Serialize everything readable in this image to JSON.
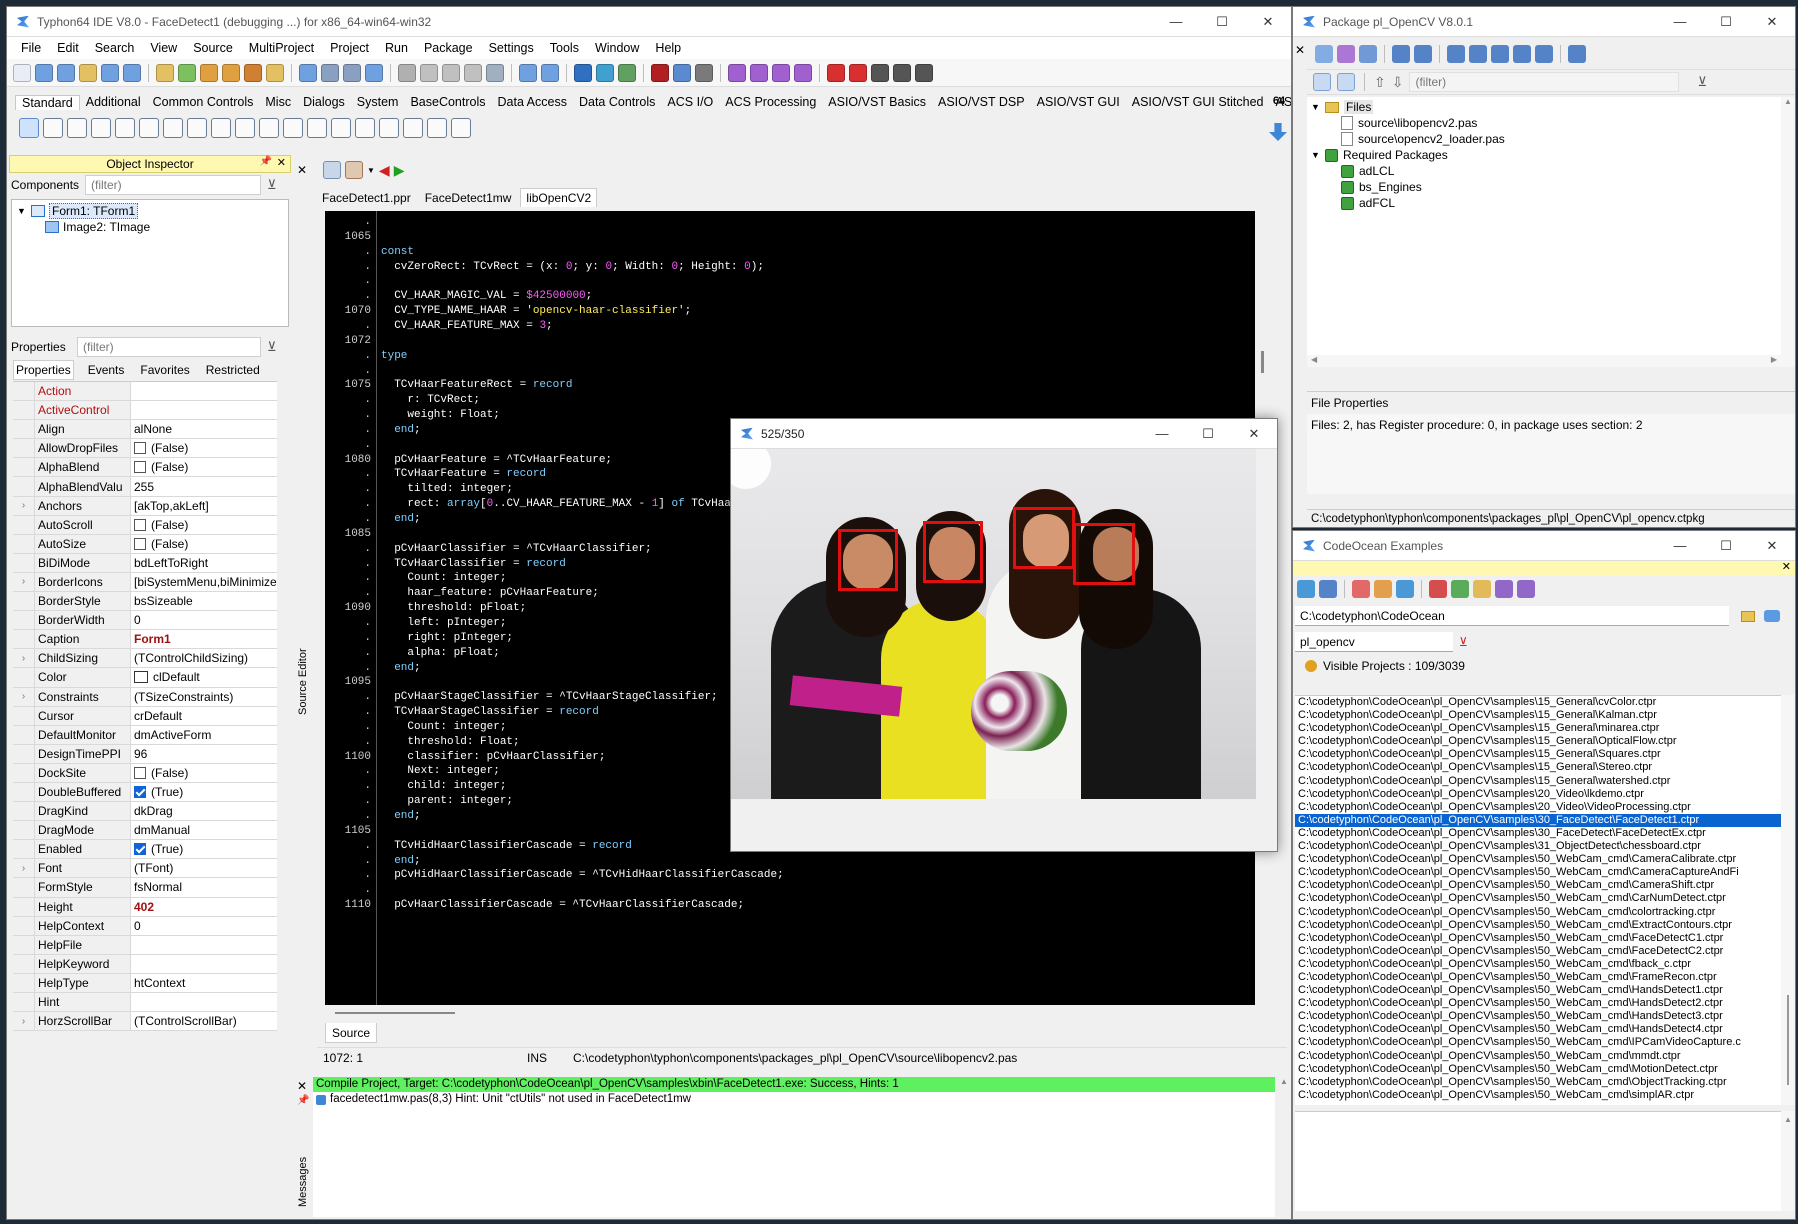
{
  "ide": {
    "title": "Typhon64 IDE V8.0 - FaceDetect1 (debugging ...) for x86_64-win64-win32",
    "menu": [
      "File",
      "Edit",
      "Search",
      "View",
      "Source",
      "MultiProject",
      "Project",
      "Run",
      "Package",
      "Settings",
      "Tools",
      "Window",
      "Help"
    ],
    "palette_tabs": [
      "Standard",
      "Additional",
      "Common Controls",
      "Misc",
      "Dialogs",
      "System",
      "BaseControls",
      "Data Access",
      "Data Controls",
      "ACS I/O",
      "ACS Processing",
      "ASIO/VST Basics",
      "ASIO/VST DSP",
      "ASIO/VST GUI",
      "ASIO/VST GUI Stitched",
      "ASIO/"
    ],
    "arch_label": "64"
  },
  "object_inspector": {
    "title": "Object Inspector",
    "components_label": "Components",
    "filter_placeholder": "(filter)",
    "tree": [
      "Form1: TForm1",
      "Image2: TImage"
    ],
    "properties_label": "Properties",
    "tabs": [
      "Properties",
      "Events",
      "Favorites",
      "Restricted"
    ],
    "rows": [
      {
        "exp": "",
        "name": "Action",
        "value": "",
        "kind": "red"
      },
      {
        "exp": "",
        "name": "ActiveControl",
        "value": "",
        "kind": "red"
      },
      {
        "exp": "",
        "name": "Align",
        "value": "alNone",
        "kind": ""
      },
      {
        "exp": "",
        "name": "AllowDropFiles",
        "value": "(False)",
        "kind": "chk"
      },
      {
        "exp": "",
        "name": "AlphaBlend",
        "value": "(False)",
        "kind": "chk"
      },
      {
        "exp": "",
        "name": "AlphaBlendValu",
        "value": "255",
        "kind": ""
      },
      {
        "exp": "›",
        "name": "Anchors",
        "value": "[akTop,akLeft]",
        "kind": ""
      },
      {
        "exp": "",
        "name": "AutoScroll",
        "value": "(False)",
        "kind": "chk"
      },
      {
        "exp": "",
        "name": "AutoSize",
        "value": "(False)",
        "kind": "chk"
      },
      {
        "exp": "",
        "name": "BiDiMode",
        "value": "bdLeftToRight",
        "kind": ""
      },
      {
        "exp": "›",
        "name": "BorderIcons",
        "value": "[biSystemMenu,biMinimize",
        "kind": ""
      },
      {
        "exp": "",
        "name": "BorderStyle",
        "value": "bsSizeable",
        "kind": ""
      },
      {
        "exp": "",
        "name": "BorderWidth",
        "value": "0",
        "kind": ""
      },
      {
        "exp": "",
        "name": "Caption",
        "value": "Form1",
        "kind": "bold"
      },
      {
        "exp": "›",
        "name": "ChildSizing",
        "value": "(TControlChildSizing)",
        "kind": ""
      },
      {
        "exp": "",
        "name": "Color",
        "value": "clDefault",
        "kind": "color"
      },
      {
        "exp": "›",
        "name": "Constraints",
        "value": "(TSizeConstraints)",
        "kind": ""
      },
      {
        "exp": "",
        "name": "Cursor",
        "value": "crDefault",
        "kind": ""
      },
      {
        "exp": "",
        "name": "DefaultMonitor",
        "value": "dmActiveForm",
        "kind": ""
      },
      {
        "exp": "",
        "name": "DesignTimePPI",
        "value": "96",
        "kind": ""
      },
      {
        "exp": "",
        "name": "DockSite",
        "value": "(False)",
        "kind": "chk"
      },
      {
        "exp": "",
        "name": "DoubleBuffered",
        "value": "(True)",
        "kind": "chkon"
      },
      {
        "exp": "",
        "name": "DragKind",
        "value": "dkDrag",
        "kind": ""
      },
      {
        "exp": "",
        "name": "DragMode",
        "value": "dmManual",
        "kind": ""
      },
      {
        "exp": "",
        "name": "Enabled",
        "value": "(True)",
        "kind": "chkon"
      },
      {
        "exp": "›",
        "name": "Font",
        "value": "(TFont)",
        "kind": ""
      },
      {
        "exp": "",
        "name": "FormStyle",
        "value": "fsNormal",
        "kind": ""
      },
      {
        "exp": "",
        "name": "Height",
        "value": "402",
        "kind": "bold"
      },
      {
        "exp": "",
        "name": "HelpContext",
        "value": "0",
        "kind": ""
      },
      {
        "exp": "",
        "name": "HelpFile",
        "value": "",
        "kind": ""
      },
      {
        "exp": "",
        "name": "HelpKeyword",
        "value": "",
        "kind": ""
      },
      {
        "exp": "",
        "name": "HelpType",
        "value": "htContext",
        "kind": ""
      },
      {
        "exp": "",
        "name": "Hint",
        "value": "",
        "kind": ""
      },
      {
        "exp": "›",
        "name": "HorzScrollBar",
        "value": "(TControlScrollBar)",
        "kind": ""
      }
    ]
  },
  "editor": {
    "tabs": [
      "FaceDetect1.ppr",
      "FaceDetect1mw",
      "libOpenCV2"
    ],
    "side_label": "Source Editor",
    "bottom_tab": "Source",
    "status_pos": "1072: 1",
    "status_mode": "INS",
    "status_path": "C:\\codetyphon\\typhon\\components\\packages_pl\\pl_OpenCV\\source\\libopencv2.pas",
    "lines": [
      {
        "n": ".",
        "t": ""
      },
      {
        "n": "1065",
        "t": ""
      },
      {
        "n": ".",
        "t": "<span class='kw'>const</span>"
      },
      {
        "n": ".",
        "t": "  cvZeroRect: TCvRect = (x: <span class='num'>0</span>; y: <span class='num'>0</span>; Width: <span class='num'>0</span>; Height: <span class='num'>0</span>);"
      },
      {
        "n": ".",
        "t": ""
      },
      {
        "n": ".",
        "t": "  CV_HAAR_MAGIC_VAL = <span class='num'>$42500000</span>;"
      },
      {
        "n": "1070",
        "t": "  CV_TYPE_NAME_HAAR = <span class='str'>'opencv-haar-classifier'</span>;"
      },
      {
        "n": ".",
        "t": "  CV_HAAR_FEATURE_MAX = <span class='num'>3</span>;"
      },
      {
        "n": "1072",
        "t": ""
      },
      {
        "n": ".",
        "t": "<span class='kw'>type</span>"
      },
      {
        "n": ".",
        "t": ""
      },
      {
        "n": "1075",
        "t": "  TCvHaarFeatureRect = <span class='kw'>record</span>"
      },
      {
        "n": ".",
        "t": "    r: TCvRect;"
      },
      {
        "n": ".",
        "t": "    weight: Float;"
      },
      {
        "n": ".",
        "t": "  <span class='kw'>end</span>;"
      },
      {
        "n": ".",
        "t": ""
      },
      {
        "n": "1080",
        "t": "  pCvHaarFeature = ^TCvHaarFeature;"
      },
      {
        "n": ".",
        "t": "  TCvHaarFeature = <span class='kw'>record</span>"
      },
      {
        "n": ".",
        "t": "    tilted: integer;"
      },
      {
        "n": ".",
        "t": "    rect: <span class='kw'>array</span>[<span class='num'>0</span>..CV_HAAR_FEATURE_MAX - <span class='num'>1</span>] <span class='kw'>of</span> TCvHaarFeatureRect;"
      },
      {
        "n": ".",
        "t": "  <span class='kw'>end</span>;"
      },
      {
        "n": "1085",
        "t": ""
      },
      {
        "n": ".",
        "t": "  pCvHaarClassifier = ^TCvHaarClassifier;"
      },
      {
        "n": ".",
        "t": "  TCvHaarClassifier = <span class='kw'>record</span>"
      },
      {
        "n": ".",
        "t": "    Count: integer;"
      },
      {
        "n": ".",
        "t": "    haar_feature: pCvHaarFeature;"
      },
      {
        "n": "1090",
        "t": "    threshold: pFloat;"
      },
      {
        "n": ".",
        "t": "    left: pInteger;"
      },
      {
        "n": ".",
        "t": "    right: pInteger;"
      },
      {
        "n": ".",
        "t": "    alpha: pFloat;"
      },
      {
        "n": ".",
        "t": "  <span class='kw'>end</span>;"
      },
      {
        "n": "1095",
        "t": ""
      },
      {
        "n": ".",
        "t": "  pCvHaarStageClassifier = ^TCvHaarStageClassifier;"
      },
      {
        "n": ".",
        "t": "  TCvHaarStageClassifier = <span class='kw'>record</span>"
      },
      {
        "n": ".",
        "t": "    Count: integer;"
      },
      {
        "n": ".",
        "t": "    threshold: Float;"
      },
      {
        "n": "1100",
        "t": "    classifier: pCvHaarClassifier;"
      },
      {
        "n": ".",
        "t": "    Next: integer;"
      },
      {
        "n": ".",
        "t": "    child: integer;"
      },
      {
        "n": ".",
        "t": "    parent: integer;"
      },
      {
        "n": ".",
        "t": "  <span class='kw'>end</span>;"
      },
      {
        "n": "1105",
        "t": ""
      },
      {
        "n": ".",
        "t": "  TCvHidHaarClassifierCascade = <span class='kw'>record</span>"
      },
      {
        "n": ".",
        "t": "  <span class='kw'>end</span>;"
      },
      {
        "n": ".",
        "t": "  pCvHidHaarClassifierCascade = ^TCvHidHaarClassifierCascade;"
      },
      {
        "n": ".",
        "t": ""
      },
      {
        "n": "1110",
        "t": "  pCvHaarClassifierCascade = ^TCvHaarClassifierCascade;"
      }
    ]
  },
  "messages": {
    "side_label": "Messages",
    "success": "Compile Project, Target: C:\\codetyphon\\CodeOcean\\pl_OpenCV\\samples\\xbin\\FaceDetect1.exe: Success, Hints: 1",
    "hint": "facedetect1mw.pas(8,3) Hint: Unit \"ctUtils\" not used in FaceDetect1mw"
  },
  "preview": {
    "title": "525/350"
  },
  "package": {
    "title": "Package pl_OpenCV V8.0.1",
    "filter_placeholder": "(filter)",
    "files_label": "Files",
    "files": [
      "source\\libopencv2.pas",
      "source\\opencv2_loader.pas"
    ],
    "required_label": "Required Packages",
    "required": [
      "adLCL",
      "bs_Engines",
      "adFCL"
    ],
    "file_props_label": "File Properties",
    "file_props": "Files: 2, has Register procedure: 0, in package uses section: 2",
    "path": "C:\\codetyphon\\typhon\\components\\packages_pl\\pl_OpenCV\\pl_opencv.ctpkg"
  },
  "codeocean": {
    "title": "CodeOcean Examples",
    "path": "C:\\codetyphon\\CodeOcean",
    "filter": "pl_opencv",
    "visible": "Visible Projects : 109/3039",
    "selected_index": 9,
    "items": [
      "C:\\codetyphon\\CodeOcean\\pl_OpenCV\\samples\\15_General\\cvColor.ctpr",
      "C:\\codetyphon\\CodeOcean\\pl_OpenCV\\samples\\15_General\\Kalman.ctpr",
      "C:\\codetyphon\\CodeOcean\\pl_OpenCV\\samples\\15_General\\minarea.ctpr",
      "C:\\codetyphon\\CodeOcean\\pl_OpenCV\\samples\\15_General\\OpticalFlow.ctpr",
      "C:\\codetyphon\\CodeOcean\\pl_OpenCV\\samples\\15_General\\Squares.ctpr",
      "C:\\codetyphon\\CodeOcean\\pl_OpenCV\\samples\\15_General\\Stereo.ctpr",
      "C:\\codetyphon\\CodeOcean\\pl_OpenCV\\samples\\15_General\\watershed.ctpr",
      "C:\\codetyphon\\CodeOcean\\pl_OpenCV\\samples\\20_Video\\lkdemo.ctpr",
      "C:\\codetyphon\\CodeOcean\\pl_OpenCV\\samples\\20_Video\\VideoProcessing.ctpr",
      "C:\\codetyphon\\CodeOcean\\pl_OpenCV\\samples\\30_FaceDetect\\FaceDetect1.ctpr",
      "C:\\codetyphon\\CodeOcean\\pl_OpenCV\\samples\\30_FaceDetect\\FaceDetectEx.ctpr",
      "C:\\codetyphon\\CodeOcean\\pl_OpenCV\\samples\\31_ObjectDetect\\chessboard.ctpr",
      "C:\\codetyphon\\CodeOcean\\pl_OpenCV\\samples\\50_WebCam_cmd\\CameraCalibrate.ctpr",
      "C:\\codetyphon\\CodeOcean\\pl_OpenCV\\samples\\50_WebCam_cmd\\CameraCaptureAndFi",
      "C:\\codetyphon\\CodeOcean\\pl_OpenCV\\samples\\50_WebCam_cmd\\CameraShift.ctpr",
      "C:\\codetyphon\\CodeOcean\\pl_OpenCV\\samples\\50_WebCam_cmd\\CarNumDetect.ctpr",
      "C:\\codetyphon\\CodeOcean\\pl_OpenCV\\samples\\50_WebCam_cmd\\colortracking.ctpr",
      "C:\\codetyphon\\CodeOcean\\pl_OpenCV\\samples\\50_WebCam_cmd\\ExtractContours.ctpr",
      "C:\\codetyphon\\CodeOcean\\pl_OpenCV\\samples\\50_WebCam_cmd\\FaceDetectC1.ctpr",
      "C:\\codetyphon\\CodeOcean\\pl_OpenCV\\samples\\50_WebCam_cmd\\FaceDetectC2.ctpr",
      "C:\\codetyphon\\CodeOcean\\pl_OpenCV\\samples\\50_WebCam_cmd\\fback_c.ctpr",
      "C:\\codetyphon\\CodeOcean\\pl_OpenCV\\samples\\50_WebCam_cmd\\FrameRecon.ctpr",
      "C:\\codetyphon\\CodeOcean\\pl_OpenCV\\samples\\50_WebCam_cmd\\HandsDetect1.ctpr",
      "C:\\codetyphon\\CodeOcean\\pl_OpenCV\\samples\\50_WebCam_cmd\\HandsDetect2.ctpr",
      "C:\\codetyphon\\CodeOcean\\pl_OpenCV\\samples\\50_WebCam_cmd\\HandsDetect3.ctpr",
      "C:\\codetyphon\\CodeOcean\\pl_OpenCV\\samples\\50_WebCam_cmd\\HandsDetect4.ctpr",
      "C:\\codetyphon\\CodeOcean\\pl_OpenCV\\samples\\50_WebCam_cmd\\IPCamVideoCapture.c",
      "C:\\codetyphon\\CodeOcean\\pl_OpenCV\\samples\\50_WebCam_cmd\\mmdt.ctpr",
      "C:\\codetyphon\\CodeOcean\\pl_OpenCV\\samples\\50_WebCam_cmd\\MotionDetect.ctpr",
      "C:\\codetyphon\\CodeOcean\\pl_OpenCV\\samples\\50_WebCam_cmd\\ObjectTracking.ctpr",
      "C:\\codetyphon\\CodeOcean\\pl_OpenCV\\samples\\50_WebCam_cmd\\simplAR.ctpr"
    ]
  }
}
